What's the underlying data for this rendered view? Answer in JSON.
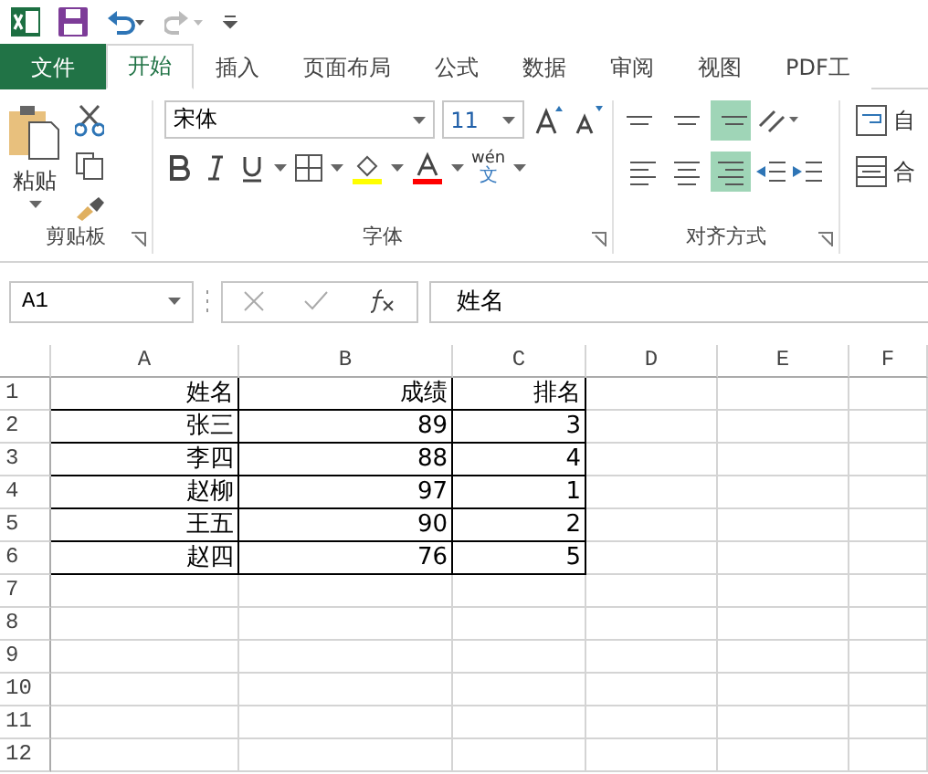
{
  "tabs": [
    {
      "label": "文件",
      "kind": "file",
      "selected": false
    },
    {
      "label": "开始",
      "kind": "tab",
      "selected": true
    },
    {
      "label": "插入",
      "kind": "tab",
      "selected": false
    },
    {
      "label": "页面布局",
      "kind": "tab",
      "selected": false
    },
    {
      "label": "公式",
      "kind": "tab",
      "selected": false
    },
    {
      "label": "数据",
      "kind": "tab",
      "selected": false
    },
    {
      "label": "审阅",
      "kind": "tab",
      "selected": false
    },
    {
      "label": "视图",
      "kind": "tab",
      "selected": false
    },
    {
      "label": "PDF工",
      "kind": "tab",
      "selected": false
    }
  ],
  "ribbon": {
    "clipboard": {
      "paste_label": "粘贴",
      "group_label": "剪贴板"
    },
    "font": {
      "font_name": "宋体",
      "font_size": "11",
      "phonetic_label": "wén",
      "phonetic_char": "文",
      "group_label": "字体"
    },
    "alignment": {
      "top_row": [
        {
          "kind": "top",
          "selected": false
        },
        {
          "kind": "middle",
          "selected": false
        },
        {
          "kind": "bottom",
          "selected": true
        }
      ],
      "bottom_row": [
        {
          "kind": "left",
          "selected": false
        },
        {
          "kind": "center",
          "selected": false
        },
        {
          "kind": "right",
          "selected": true
        }
      ],
      "group_label": "对齐方式"
    },
    "extra": {
      "wrap_label": "自",
      "merge_label": "合"
    }
  },
  "formula_bar": {
    "name_box": "A1",
    "formula": "姓名"
  },
  "sheet": {
    "columns": [
      "A",
      "B",
      "C",
      "D",
      "E",
      "F"
    ],
    "rows": [
      {
        "label": "1",
        "cells": [
          "姓名",
          "成绩",
          "排名"
        ]
      },
      {
        "label": "2",
        "cells": [
          "张三",
          "89",
          "3"
        ]
      },
      {
        "label": "3",
        "cells": [
          "李四",
          "88",
          "4"
        ]
      },
      {
        "label": "4",
        "cells": [
          "赵柳",
          "97",
          "1"
        ]
      },
      {
        "label": "5",
        "cells": [
          "王五",
          "90",
          "2"
        ]
      },
      {
        "label": "6",
        "cells": [
          "赵四",
          "76",
          "5"
        ]
      },
      {
        "label": "7",
        "cells": []
      },
      {
        "label": "8",
        "cells": []
      },
      {
        "label": "9",
        "cells": []
      },
      {
        "label": "10",
        "cells": []
      },
      {
        "label": "11",
        "cells": []
      },
      {
        "label": "12",
        "cells": []
      }
    ]
  }
}
